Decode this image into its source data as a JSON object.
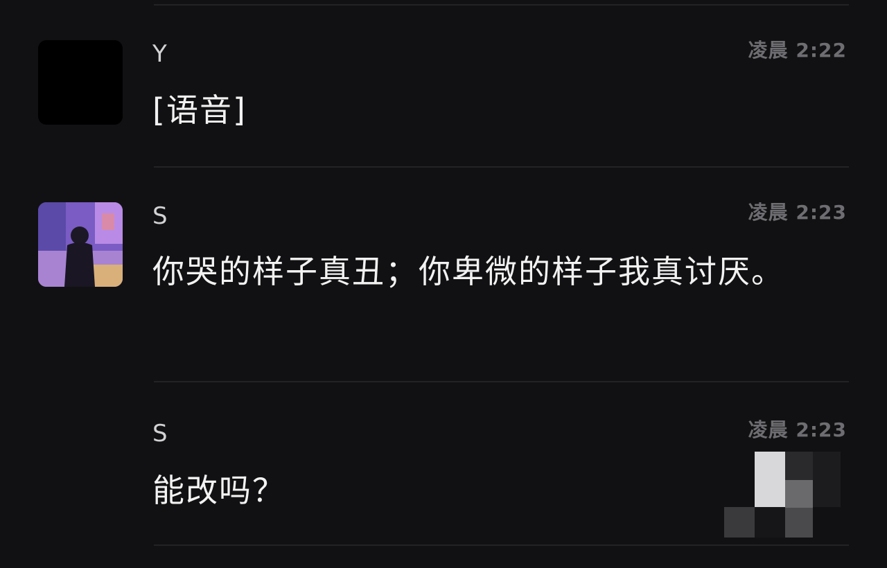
{
  "messages": [
    {
      "sender": "Y",
      "time": "凌晨 2:22",
      "text": "[语音]",
      "avatar": "blank-avatar"
    },
    {
      "sender": "S",
      "time": "凌晨 2:23",
      "text": "你哭的样子真丑；你卑微的样子我真讨厌。",
      "avatar": "photo-avatar"
    },
    {
      "sender": "S",
      "time": "凌晨 2:23",
      "text": "能改吗？",
      "avatar": ""
    }
  ],
  "colors": {
    "background": "#111113",
    "text": "#f2f2f2",
    "sender": "#d2d2d4",
    "time": "#6e6e72",
    "divider": "#232326"
  }
}
